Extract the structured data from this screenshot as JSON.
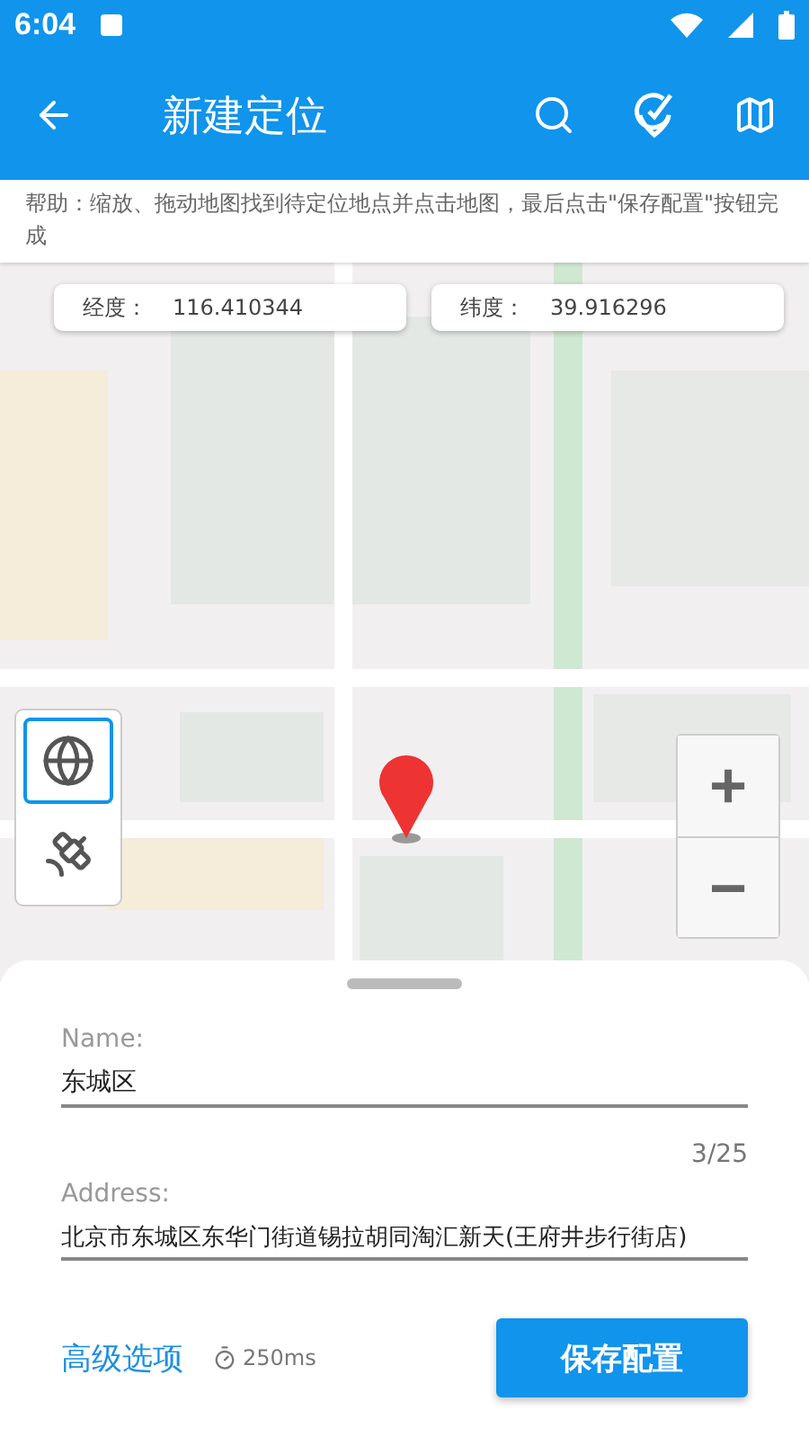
{
  "status_bar": {
    "time": "6:04"
  },
  "app_bar": {
    "title": "新建定位"
  },
  "help": "帮助：缩放、拖动地图找到待定位地点并点击地图，最后点击\"保存配置\"按钮完成",
  "coords": [
    {
      "label": "经度：",
      "value": "116.410344"
    },
    {
      "label": "纬度：",
      "value": "39.916296"
    }
  ],
  "map_layers": [
    {
      "kind": "globe",
      "selected": true
    },
    {
      "kind": "satellite",
      "selected": false
    }
  ],
  "zoom": {
    "in": "+",
    "out": "−"
  },
  "form": {
    "name_label": "Name:",
    "name_value": "东城区",
    "counter": "3/25",
    "address_label": "Address:",
    "address_value": "北京市东城区东华门街道锡拉胡同淘汇新天(王府井步行街店)"
  },
  "advanced": "高级选项",
  "interval": "250ms",
  "save": "保存配置"
}
